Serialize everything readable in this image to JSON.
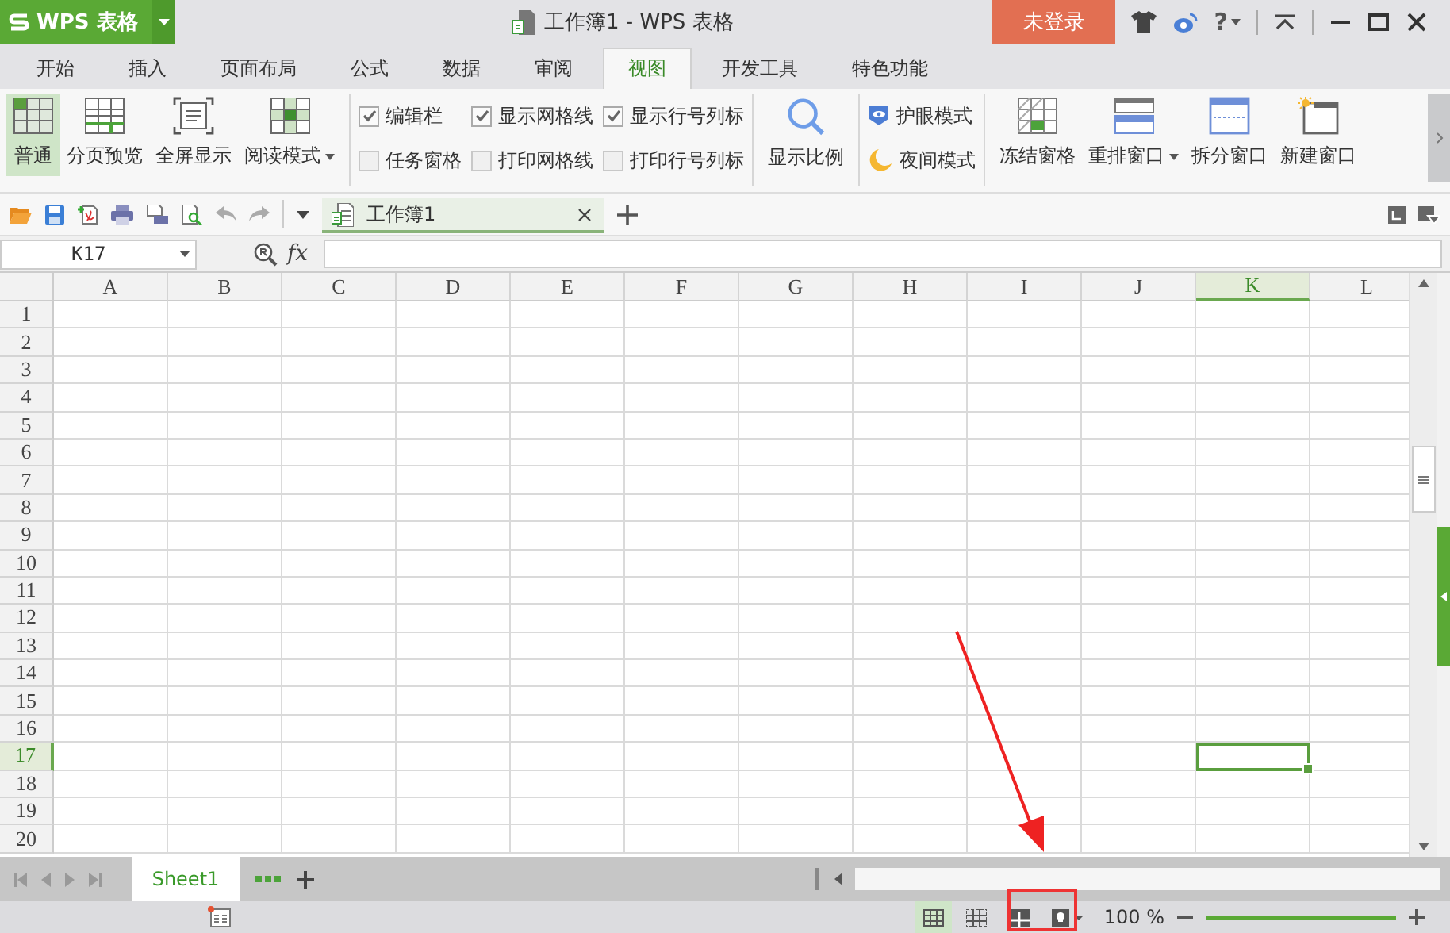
{
  "app": {
    "logo": "WPS 表格"
  },
  "window": {
    "title": "工作簿1 - WPS 表格"
  },
  "login_button": "未登录",
  "help": "?",
  "tabs": [
    {
      "label": "开始",
      "selected": false
    },
    {
      "label": "插入",
      "selected": false
    },
    {
      "label": "页面布局",
      "selected": false
    },
    {
      "label": "公式",
      "selected": false
    },
    {
      "label": "数据",
      "selected": false
    },
    {
      "label": "审阅",
      "selected": false
    },
    {
      "label": "视图",
      "selected": true
    },
    {
      "label": "开发工具",
      "selected": false
    },
    {
      "label": "特色功能",
      "selected": false
    }
  ],
  "ribbon": {
    "view_modes": [
      {
        "label": "普通",
        "kind": "normal",
        "selected": true,
        "dropdown": false
      },
      {
        "label": "分页预览",
        "kind": "pagebreak",
        "selected": false,
        "dropdown": false
      },
      {
        "label": "全屏显示",
        "kind": "fullscreen",
        "selected": false,
        "dropdown": false
      },
      {
        "label": "阅读模式",
        "kind": "reading",
        "selected": false,
        "dropdown": true
      }
    ],
    "options": [
      {
        "label": "编辑栏",
        "checked": true
      },
      {
        "label": "任务窗格",
        "checked": false
      },
      {
        "label": "显示网格线",
        "checked": true
      },
      {
        "label": "打印网格线",
        "checked": false
      },
      {
        "label": "显示行号列标",
        "checked": true
      },
      {
        "label": "打印行号列标",
        "checked": false
      }
    ],
    "zoom_button": "显示比例",
    "modes": [
      {
        "label": "护眼模式",
        "kind": "eye"
      },
      {
        "label": "夜间模式",
        "kind": "night"
      }
    ],
    "window_tools": [
      {
        "label": "冻结窗格",
        "kind": "freeze",
        "dropdown": false
      },
      {
        "label": "重排窗口",
        "kind": "arrange",
        "dropdown": true
      },
      {
        "label": "拆分窗口",
        "kind": "split",
        "dropdown": false
      },
      {
        "label": "新建窗口",
        "kind": "new",
        "dropdown": false
      }
    ]
  },
  "document_tabs": [
    {
      "label": "工作簿1",
      "selected": true
    }
  ],
  "name_box": "K17",
  "formula_label": "fx",
  "sheet": {
    "columns": [
      {
        "label": "A",
        "selected": false
      },
      {
        "label": "B",
        "selected": false
      },
      {
        "label": "C",
        "selected": false
      },
      {
        "label": "D",
        "selected": false
      },
      {
        "label": "E",
        "selected": false
      },
      {
        "label": "F",
        "selected": false
      },
      {
        "label": "G",
        "selected": false
      },
      {
        "label": "H",
        "selected": false
      },
      {
        "label": "I",
        "selected": false
      },
      {
        "label": "J",
        "selected": false
      },
      {
        "label": "K",
        "selected": true
      },
      {
        "label": "L",
        "selected": false
      }
    ],
    "rows": [
      {
        "label": "1",
        "selected": false
      },
      {
        "label": "2",
        "selected": false
      },
      {
        "label": "3",
        "selected": false
      },
      {
        "label": "4",
        "selected": false
      },
      {
        "label": "5",
        "selected": false
      },
      {
        "label": "6",
        "selected": false
      },
      {
        "label": "7",
        "selected": false
      },
      {
        "label": "8",
        "selected": false
      },
      {
        "label": "9",
        "selected": false
      },
      {
        "label": "10",
        "selected": false
      },
      {
        "label": "11",
        "selected": false
      },
      {
        "label": "12",
        "selected": false
      },
      {
        "label": "13",
        "selected": false
      },
      {
        "label": "14",
        "selected": false
      },
      {
        "label": "15",
        "selected": false
      },
      {
        "label": "16",
        "selected": false
      },
      {
        "label": "17",
        "selected": true
      },
      {
        "label": "18",
        "selected": false
      },
      {
        "label": "19",
        "selected": false
      },
      {
        "label": "20",
        "selected": false
      }
    ]
  },
  "sheet_tabs": [
    {
      "label": "Sheet1",
      "selected": true
    }
  ],
  "status_bar": {
    "view_buttons": [
      {
        "kind": "normal",
        "selected": true
      },
      {
        "kind": "pagebreak",
        "selected": false
      },
      {
        "kind": "layout",
        "selected": false
      },
      {
        "kind": "reading",
        "selected": false
      }
    ],
    "zoom": "100 %"
  }
}
